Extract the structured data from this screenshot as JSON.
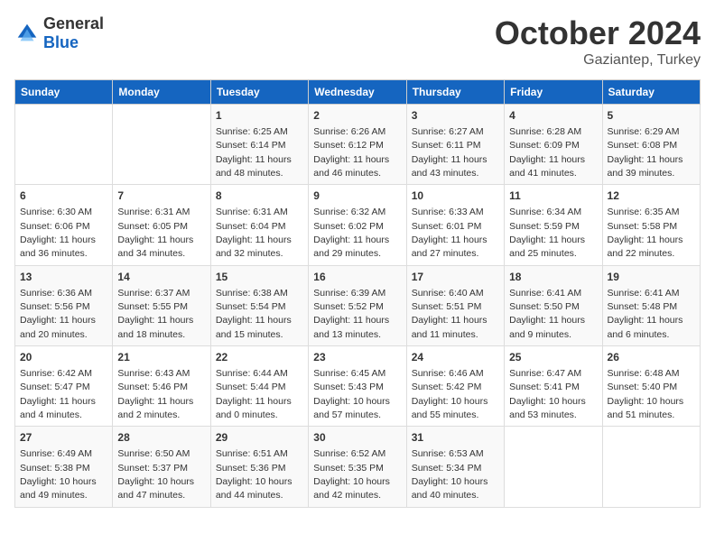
{
  "header": {
    "logo_general": "General",
    "logo_blue": "Blue",
    "month": "October 2024",
    "location": "Gaziantep, Turkey"
  },
  "days_of_week": [
    "Sunday",
    "Monday",
    "Tuesday",
    "Wednesday",
    "Thursday",
    "Friday",
    "Saturday"
  ],
  "weeks": [
    [
      {
        "day": "",
        "info": ""
      },
      {
        "day": "",
        "info": ""
      },
      {
        "day": "1",
        "info": "Sunrise: 6:25 AM\nSunset: 6:14 PM\nDaylight: 11 hours\nand 48 minutes."
      },
      {
        "day": "2",
        "info": "Sunrise: 6:26 AM\nSunset: 6:12 PM\nDaylight: 11 hours\nand 46 minutes."
      },
      {
        "day": "3",
        "info": "Sunrise: 6:27 AM\nSunset: 6:11 PM\nDaylight: 11 hours\nand 43 minutes."
      },
      {
        "day": "4",
        "info": "Sunrise: 6:28 AM\nSunset: 6:09 PM\nDaylight: 11 hours\nand 41 minutes."
      },
      {
        "day": "5",
        "info": "Sunrise: 6:29 AM\nSunset: 6:08 PM\nDaylight: 11 hours\nand 39 minutes."
      }
    ],
    [
      {
        "day": "6",
        "info": "Sunrise: 6:30 AM\nSunset: 6:06 PM\nDaylight: 11 hours\nand 36 minutes."
      },
      {
        "day": "7",
        "info": "Sunrise: 6:31 AM\nSunset: 6:05 PM\nDaylight: 11 hours\nand 34 minutes."
      },
      {
        "day": "8",
        "info": "Sunrise: 6:31 AM\nSunset: 6:04 PM\nDaylight: 11 hours\nand 32 minutes."
      },
      {
        "day": "9",
        "info": "Sunrise: 6:32 AM\nSunset: 6:02 PM\nDaylight: 11 hours\nand 29 minutes."
      },
      {
        "day": "10",
        "info": "Sunrise: 6:33 AM\nSunset: 6:01 PM\nDaylight: 11 hours\nand 27 minutes."
      },
      {
        "day": "11",
        "info": "Sunrise: 6:34 AM\nSunset: 5:59 PM\nDaylight: 11 hours\nand 25 minutes."
      },
      {
        "day": "12",
        "info": "Sunrise: 6:35 AM\nSunset: 5:58 PM\nDaylight: 11 hours\nand 22 minutes."
      }
    ],
    [
      {
        "day": "13",
        "info": "Sunrise: 6:36 AM\nSunset: 5:56 PM\nDaylight: 11 hours\nand 20 minutes."
      },
      {
        "day": "14",
        "info": "Sunrise: 6:37 AM\nSunset: 5:55 PM\nDaylight: 11 hours\nand 18 minutes."
      },
      {
        "day": "15",
        "info": "Sunrise: 6:38 AM\nSunset: 5:54 PM\nDaylight: 11 hours\nand 15 minutes."
      },
      {
        "day": "16",
        "info": "Sunrise: 6:39 AM\nSunset: 5:52 PM\nDaylight: 11 hours\nand 13 minutes."
      },
      {
        "day": "17",
        "info": "Sunrise: 6:40 AM\nSunset: 5:51 PM\nDaylight: 11 hours\nand 11 minutes."
      },
      {
        "day": "18",
        "info": "Sunrise: 6:41 AM\nSunset: 5:50 PM\nDaylight: 11 hours\nand 9 minutes."
      },
      {
        "day": "19",
        "info": "Sunrise: 6:41 AM\nSunset: 5:48 PM\nDaylight: 11 hours\nand 6 minutes."
      }
    ],
    [
      {
        "day": "20",
        "info": "Sunrise: 6:42 AM\nSunset: 5:47 PM\nDaylight: 11 hours\nand 4 minutes."
      },
      {
        "day": "21",
        "info": "Sunrise: 6:43 AM\nSunset: 5:46 PM\nDaylight: 11 hours\nand 2 minutes."
      },
      {
        "day": "22",
        "info": "Sunrise: 6:44 AM\nSunset: 5:44 PM\nDaylight: 11 hours\nand 0 minutes."
      },
      {
        "day": "23",
        "info": "Sunrise: 6:45 AM\nSunset: 5:43 PM\nDaylight: 10 hours\nand 57 minutes."
      },
      {
        "day": "24",
        "info": "Sunrise: 6:46 AM\nSunset: 5:42 PM\nDaylight: 10 hours\nand 55 minutes."
      },
      {
        "day": "25",
        "info": "Sunrise: 6:47 AM\nSunset: 5:41 PM\nDaylight: 10 hours\nand 53 minutes."
      },
      {
        "day": "26",
        "info": "Sunrise: 6:48 AM\nSunset: 5:40 PM\nDaylight: 10 hours\nand 51 minutes."
      }
    ],
    [
      {
        "day": "27",
        "info": "Sunrise: 6:49 AM\nSunset: 5:38 PM\nDaylight: 10 hours\nand 49 minutes."
      },
      {
        "day": "28",
        "info": "Sunrise: 6:50 AM\nSunset: 5:37 PM\nDaylight: 10 hours\nand 47 minutes."
      },
      {
        "day": "29",
        "info": "Sunrise: 6:51 AM\nSunset: 5:36 PM\nDaylight: 10 hours\nand 44 minutes."
      },
      {
        "day": "30",
        "info": "Sunrise: 6:52 AM\nSunset: 5:35 PM\nDaylight: 10 hours\nand 42 minutes."
      },
      {
        "day": "31",
        "info": "Sunrise: 6:53 AM\nSunset: 5:34 PM\nDaylight: 10 hours\nand 40 minutes."
      },
      {
        "day": "",
        "info": ""
      },
      {
        "day": "",
        "info": ""
      }
    ]
  ]
}
